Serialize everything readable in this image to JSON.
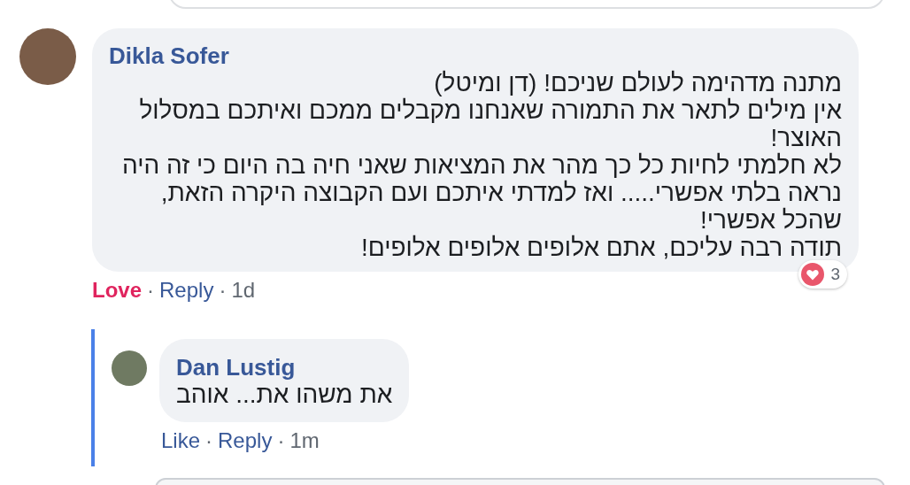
{
  "comment": {
    "author": "Dikla Sofer",
    "paragraphs": [
      "מתנה מדהימה לעולם שניכם! (דן ומיטל)",
      "אין מילים לתאר את התמורה שאנחנו מקבלים ממכם ואיתכם במסלול האוצר!",
      "לא חלמתי לחיות כל כך מהר את המציאות שאני חיה בה היום כי זה היה נראה בלתי אפשרי..... ואז למדתי איתכם ועם הקבוצה היקרה הזאת, שהכל אפשרי!",
      "תודה רבה עליכם, אתם אלופים אלופים אלופים!"
    ],
    "reaction_action": "Love",
    "reacted": true,
    "separator_a": "·",
    "separator_b": "·",
    "reply_action": "Reply",
    "time": "1d",
    "reaction_count": "3",
    "replies": [
      {
        "author": "Dan Lustig",
        "paragraphs": [
          "את משהו את... אוהב"
        ],
        "reaction_action": "Like",
        "reacted": false,
        "separator_a": "·",
        "separator_b": "·",
        "reply_action": "Reply",
        "time": "1m"
      }
    ]
  }
}
